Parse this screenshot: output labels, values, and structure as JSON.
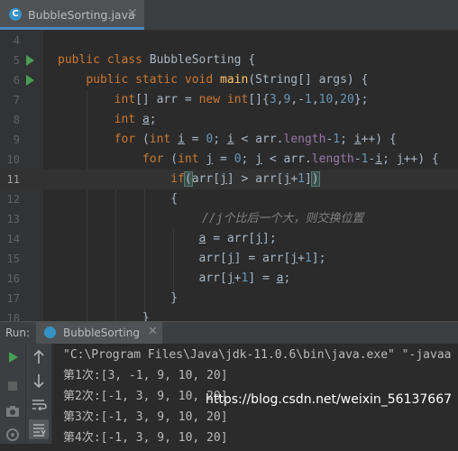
{
  "tab": {
    "icon": "C",
    "label": "BubbleSorting.java",
    "close": "✕"
  },
  "editor": {
    "lines": [
      {
        "num": "4"
      },
      {
        "num": "5"
      },
      {
        "num": "6"
      },
      {
        "num": "7"
      },
      {
        "num": "8"
      },
      {
        "num": "9"
      },
      {
        "num": "10"
      },
      {
        "num": "11"
      },
      {
        "num": "12"
      },
      {
        "num": "13"
      },
      {
        "num": "14"
      },
      {
        "num": "15"
      },
      {
        "num": "16"
      },
      {
        "num": "17"
      },
      {
        "num": "18"
      }
    ],
    "comment": "//j个比后一个大，则交换位置"
  },
  "run_panel": {
    "label": "Run:",
    "tab_label": "BubbleSorting",
    "close": "✕",
    "output": [
      "\"C:\\Program Files\\Java\\jdk-11.0.6\\bin\\java.exe\" \"-javaa",
      "第1次:[3, -1, 9, 10, 20]",
      "第2次:[-1, 3, 9, 10, 20]",
      "第3次:[-1, 3, 9, 10, 20]",
      "第4次:[-1, 3, 9, 10, 20]"
    ]
  },
  "watermark": "https://blog.csdn.net/weixin_56137667",
  "colors": {
    "keyword": "#cc7832",
    "number": "#6897bb",
    "method": "#ffc66d",
    "field": "#9876aa",
    "run_green": "#499c54"
  }
}
